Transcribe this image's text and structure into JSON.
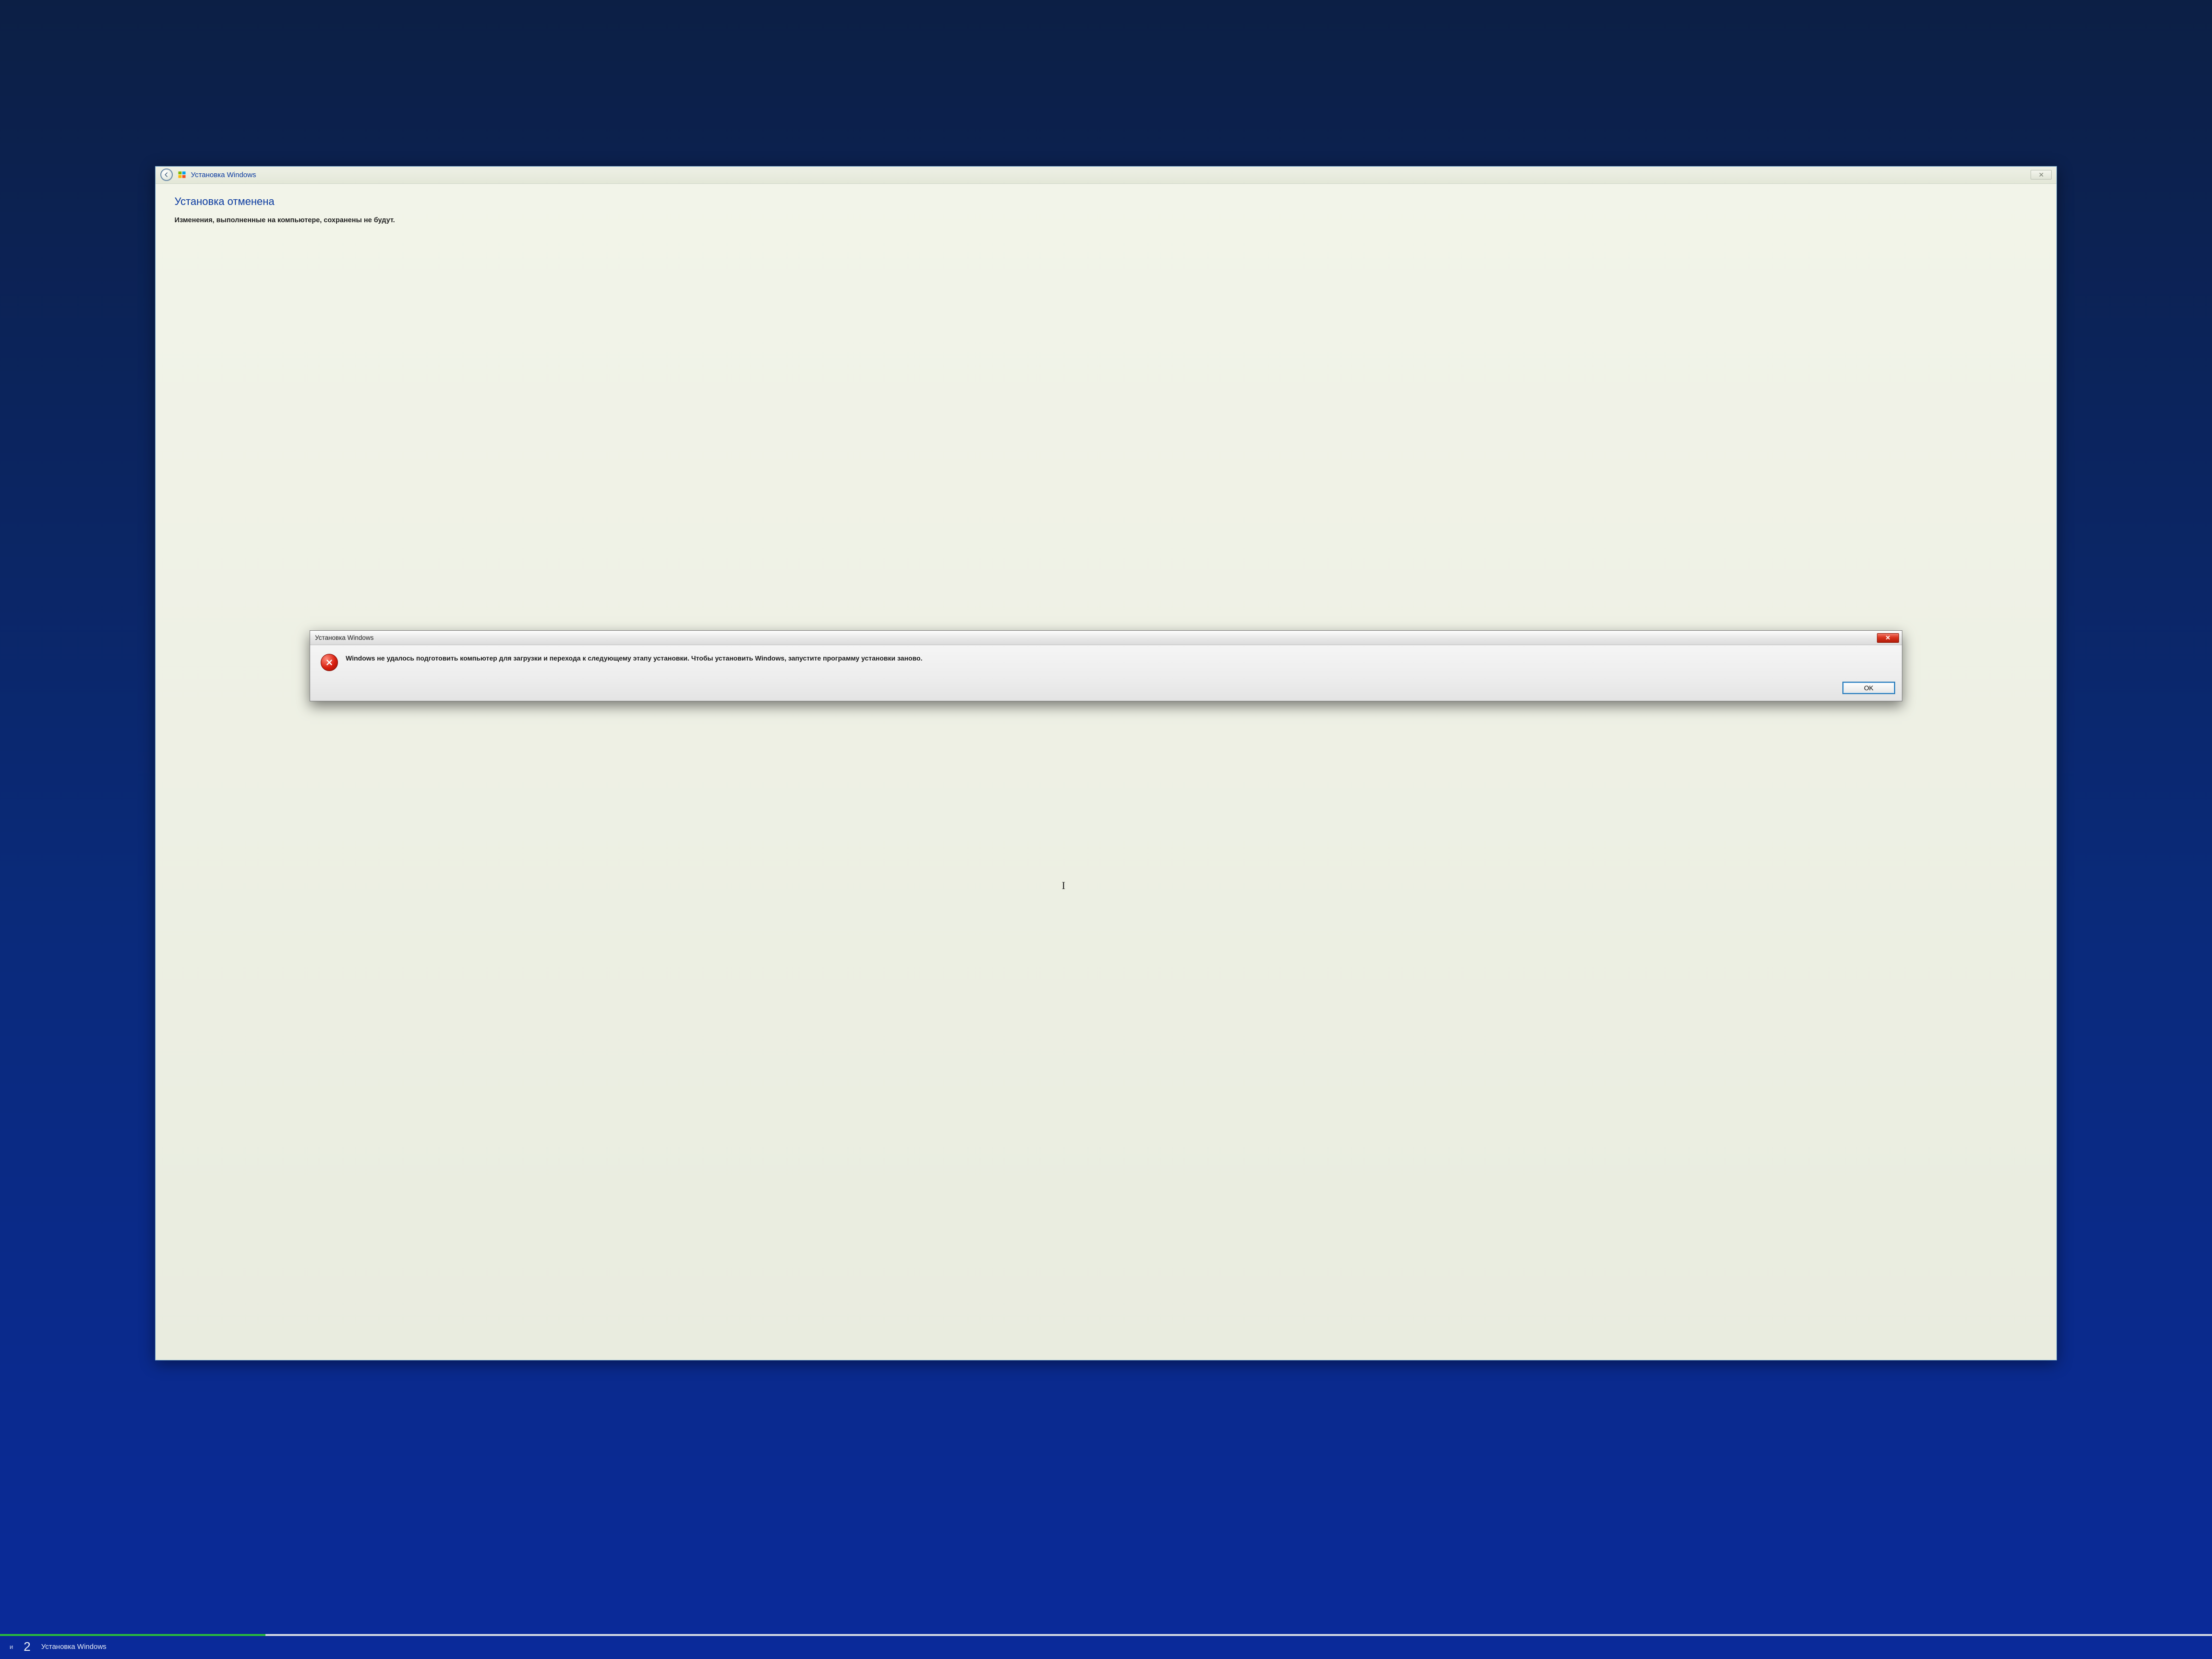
{
  "setup_window": {
    "title": "Установка Windows",
    "close_glyph": "✕",
    "heading": "Установка отменена",
    "subtext": "Изменения, выполненные на компьютере, сохранены не будут."
  },
  "modal": {
    "title": "Установка Windows",
    "close_glyph": "✕",
    "message": "Windows не удалось подготовить компьютер для загрузки и перехода к следующему этапу установки. Чтобы установить Windows, запустите программу установки заново.",
    "ok_label": "OK"
  },
  "taskbar": {
    "left_fragment": "и",
    "count": "2",
    "title": "Установка Windows"
  },
  "cursor_glyph": "I"
}
